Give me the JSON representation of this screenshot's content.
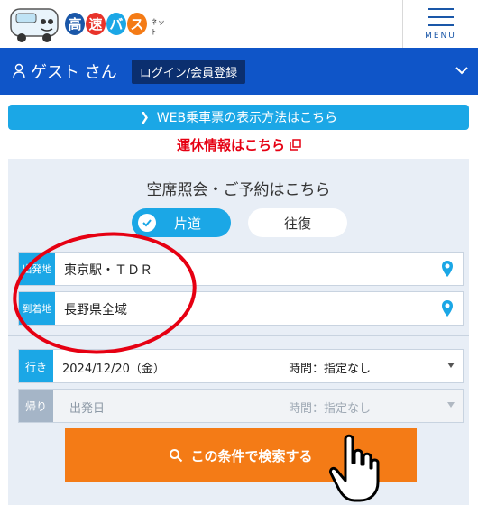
{
  "header": {
    "logo": {
      "chars": [
        "高",
        "速",
        "バ",
        "ス"
      ],
      "colors": [
        "#1a57a8",
        "#e8332a",
        "#1ba7e6",
        "#f47b16"
      ],
      "suffix": "ネット"
    },
    "menu_label": "MENU"
  },
  "guest_bar": {
    "name": "ゲスト さん",
    "login_label": "ログイン/会員登録"
  },
  "web_ticket_link": "WEB乗車票の表示方法はこちら",
  "suspension_link": "運休情報はこちら",
  "search": {
    "title": "空席照会・ご予約はこちら",
    "one_way_label": "片道",
    "round_trip_label": "往復",
    "departure": {
      "tag": "出発地",
      "value": "東京駅・ＴＤＲ"
    },
    "arrival": {
      "tag": "到着地",
      "value": "長野県全域"
    },
    "outbound": {
      "tag": "行き",
      "date": "2024/12/20（金）",
      "time": "時間：指定なし"
    },
    "return": {
      "tag": "帰り",
      "date": "出発日",
      "time": "時間：指定なし"
    },
    "submit_label": "この条件で検索する"
  },
  "colors": {
    "primary_blue": "#0f55c8",
    "accent_cyan": "#1ba7e6",
    "alert_red": "#e60012",
    "cta_orange": "#f47b16"
  }
}
